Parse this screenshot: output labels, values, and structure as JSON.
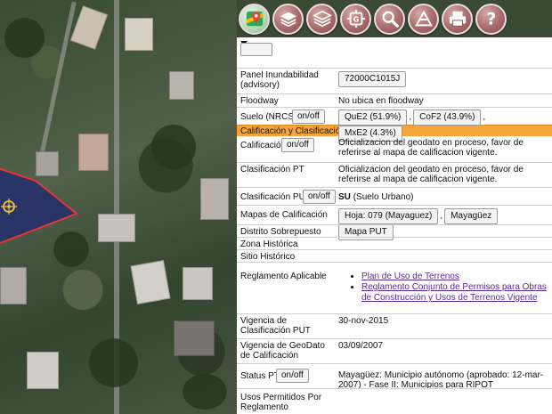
{
  "toolbar": {
    "buttons": [
      {
        "id": "maps",
        "icon": "google-maps-icon"
      },
      {
        "id": "layers",
        "icon": "layers-icon"
      },
      {
        "id": "layers-stack",
        "icon": "layers-stack-icon"
      },
      {
        "id": "geolocate",
        "icon": "gps-icon"
      },
      {
        "id": "search",
        "icon": "search-icon"
      },
      {
        "id": "measure",
        "icon": "measure-icon"
      },
      {
        "id": "print",
        "icon": "print-icon"
      },
      {
        "id": "help",
        "icon": "help-icon"
      }
    ]
  },
  "panel": {
    "top_button_label": "",
    "rows": {
      "panel_inundabilidad": {
        "label": "Panel Inundabilidad (advisory)",
        "button": "72000C1015J"
      },
      "floodway": {
        "label": "Floodway",
        "value": "No ubica en floodway"
      },
      "suelo": {
        "label": "Suelo (NRCS)",
        "toggle": "on/off",
        "chips": [
          "QuE2 (51.9%)",
          "CoF2 (43.9%)",
          "MxE2 (4.3%)"
        ],
        "sep": ","
      },
      "section_header": "Calificación y Clasificación de Suelo",
      "calificacion": {
        "label": "Calificación",
        "toggle": "on/off",
        "value": "Oficializacion del geodato en proceso, favor de referirse al mapa de calificacion vigente."
      },
      "clasificacion_pt": {
        "label": "Clasificación PT",
        "value": "Oficializacion del geodato en proceso, favor de referirse al mapa de calificacion vigente."
      },
      "clasificacion_put": {
        "label": "Clasificación PUT",
        "toggle": "on/off",
        "code": "SU",
        "value": "(Suelo Urbano)"
      },
      "mapas": {
        "label": "Mapas de Calificación",
        "chips": [
          "Hoja: 079 (Mayaguez)",
          "Mayagüez",
          "Mapa PUT"
        ],
        "sep": ","
      },
      "distrito": {
        "label": "Distrito Sobrepuesto"
      },
      "zona": {
        "label": "Zona Histórica"
      },
      "sitio": {
        "label": "Sitio Histórico"
      },
      "reglamento": {
        "label": "Reglamento Aplicable",
        "links": [
          "Plan de Uso de Terrenos",
          "Reglamento Conjunto de Permisos para Obras de Construcción y Usos de Terrenos Vigente"
        ]
      },
      "vigencia_put": {
        "label": "Vigencia de Clasificación PUT",
        "value": "30-nov-2015"
      },
      "vigencia_geodato": {
        "label": "Vigencia de GeoDato de Calificación",
        "value": "03/09/2007"
      },
      "status_pt": {
        "label": "Status PT",
        "toggle": "on/off",
        "value": "Mayagüez: Municipio autónomo (aprobado: 12-mar-2007) - Fase II: Municipios para RIPOT"
      },
      "usos": {
        "label": "Usos Permitidos Por Reglamento"
      }
    }
  },
  "colors": {
    "section_header": "#f7a53a",
    "polygon_fill": "#1f2a6e",
    "polygon_stroke": "#e8343a",
    "toolbar_button": "#a86a6a",
    "link": "#5a28a0"
  }
}
